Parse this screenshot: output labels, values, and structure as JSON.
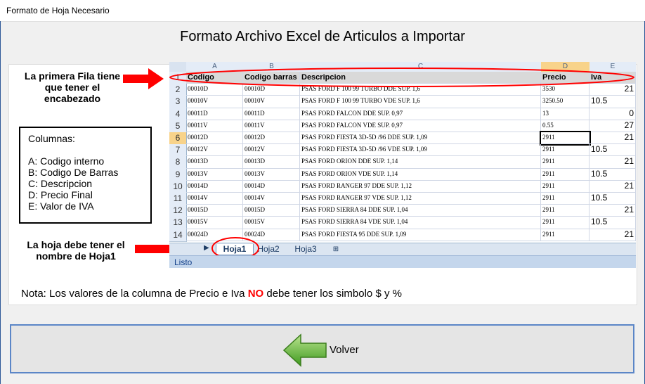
{
  "window": {
    "title": "Formato de Hoja Necesario"
  },
  "heading": "Formato Archivo Excel de Articulos a Importar",
  "notes": {
    "first_row": "La primera Fila tiene que tener el encabezado",
    "sheet_name": "La hoja debe tener el nombre de Hoja1"
  },
  "columns_box": {
    "title": "Columnas:",
    "items": [
      "A: Codigo interno",
      "B: Codigo De Barras",
      "C: Descripcion",
      "D: Precio Final",
      "E: Valor de IVA"
    ]
  },
  "spreadsheet": {
    "column_letters": [
      "A",
      "B",
      "C",
      "D",
      "E"
    ],
    "header": [
      "Codigo",
      "Codigo barras",
      "Descripcion",
      "Precio",
      "Iva"
    ],
    "rows": [
      [
        "00010D",
        "00010D",
        "PSAS FORD F 100 99 TURBO DDE SUP. 1,6",
        "3530",
        "21"
      ],
      [
        "00010V",
        "00010V",
        "PSAS FORD F 100 99 TURBO VDE SUP. 1,6",
        "3250.50",
        "10.5"
      ],
      [
        "00011D",
        "00011D",
        "PSAS FORD FALCON DDE SUP. 0,97",
        "13",
        "0"
      ],
      [
        "00011V",
        "00011V",
        "PSAS FORD FALCON VDE SUP. 0,97",
        "0.55",
        "27"
      ],
      [
        "00012D",
        "00012D",
        "PSAS FORD FIESTA 3D-5D /96 DDE SUP. 1,09",
        "2911",
        "21"
      ],
      [
        "00012V",
        "00012V",
        "PSAS FORD FIESTA 3D-5D /96 VDE SUP. 1,09",
        "2911",
        "10.5"
      ],
      [
        "00013D",
        "00013D",
        "PSAS FORD ORION DDE SUP. 1,14",
        "2911",
        "21"
      ],
      [
        "00013V",
        "00013V",
        "PSAS FORD ORION VDE SUP. 1,14",
        "2911",
        "10.5"
      ],
      [
        "00014D",
        "00014D",
        "PSAS FORD RANGER 97 DDE SUP. 1,12",
        "2911",
        "21"
      ],
      [
        "00014V",
        "00014V",
        "PSAS FORD RANGER 97 VDE SUP. 1,12",
        "2911",
        "10.5"
      ],
      [
        "00015D",
        "00015D",
        "PSAS FORD SIERRA 84 DDE SUP. 1,04",
        "2911",
        "21"
      ],
      [
        "00015V",
        "00015V",
        "PSAS FORD SIERRA 84 VDE SUP. 1,04",
        "2911",
        "10.5"
      ],
      [
        "00024D",
        "00024D",
        "PSAS FORD FIESTA 95 DDE SUP. 1,09",
        "2911",
        "21"
      ]
    ],
    "tabs": [
      "Hoja1",
      "Hoja2",
      "Hoja3"
    ],
    "status": "Listo"
  },
  "bottom_note": {
    "before": "Nota: Los valores de la columna de Precio e Iva ",
    "emphasis": "NO",
    "after": " debe tener los simbolo $ y %"
  },
  "volver_button": {
    "label": "Volver"
  },
  "colors": {
    "highlight_red": "#ff0000",
    "arrow_green": "#5aae2f",
    "sheet_header_blue": "#e4ecf7"
  }
}
